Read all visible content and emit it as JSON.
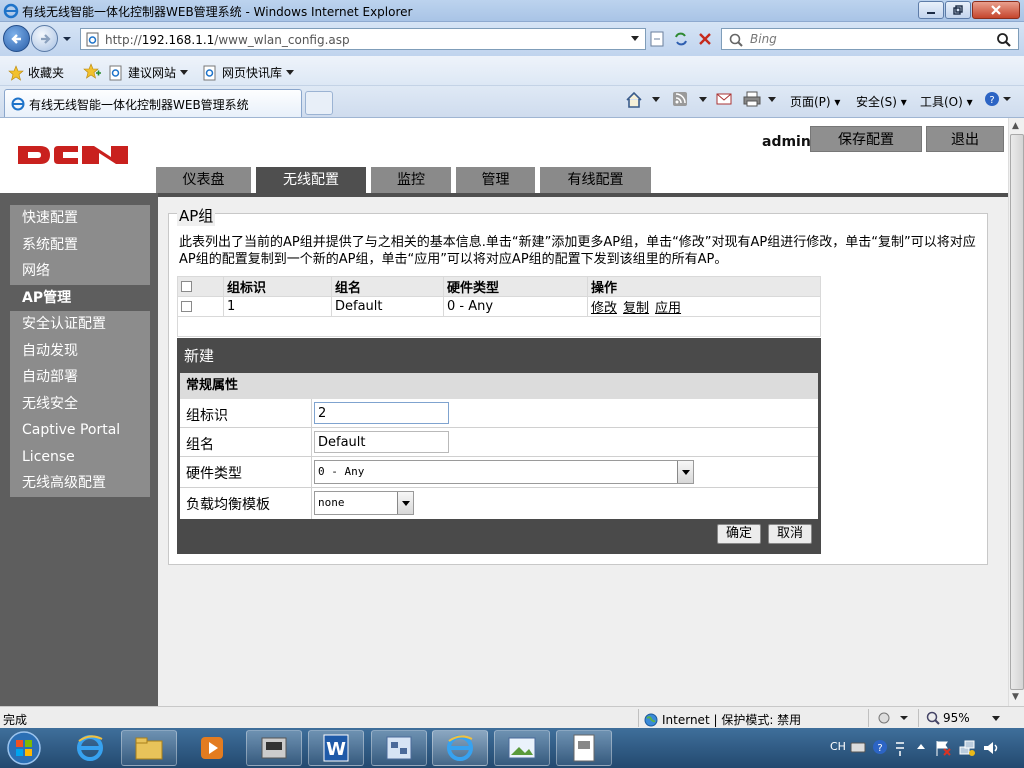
{
  "browser": {
    "window_title": "有线无线智能一体化控制器WEB管理系统 - Windows Internet Explorer",
    "url_prefix": "http://",
    "url_host": "192.168.1.1",
    "url_path": "/www_wlan_config.asp",
    "search_placeholder": "Bing",
    "favorites_label": "收藏夹",
    "suggested_sites": "建议网站",
    "web_slices": "网页快讯库",
    "tab_title": "有线无线智能一体化控制器WEB管理系统",
    "cmd_page": "页面(P)",
    "cmd_safety": "安全(S)",
    "cmd_tools": "工具(O)"
  },
  "header": {
    "logo": "DCN",
    "user": "admin",
    "save_config": "保存配置",
    "logout": "退出"
  },
  "main_tabs": [
    {
      "label": "仪表盘",
      "active": false
    },
    {
      "label": "无线配置",
      "active": true
    },
    {
      "label": "监控",
      "active": false
    },
    {
      "label": "管理",
      "active": false
    },
    {
      "label": "有线配置",
      "active": false
    }
  ],
  "sidebar": {
    "items": [
      {
        "label": "快速配置",
        "active": false
      },
      {
        "label": "系统配置",
        "active": false
      },
      {
        "label": "网络",
        "active": false
      },
      {
        "label": "AP管理",
        "active": true
      },
      {
        "label": "安全认证配置",
        "active": false
      },
      {
        "label": "自动发现",
        "active": false
      },
      {
        "label": "自动部署",
        "active": false
      },
      {
        "label": "无线安全",
        "active": false
      },
      {
        "label": "Captive Portal",
        "active": false
      },
      {
        "label": "License",
        "active": false
      },
      {
        "label": "无线高级配置",
        "active": false
      }
    ]
  },
  "ap_group": {
    "title": "AP组",
    "description": "此表列出了当前的AP组并提供了与之相关的基本信息.单击“新建”添加更多AP组，单击“修改”对现有AP组进行修改，单击“复制”可以将对应AP组的配置复制到一个新的AP组，单击“应用”可以将对应AP组的配置下发到该组里的所有AP。",
    "columns": [
      "组标识",
      "组名",
      "硬件类型",
      "操作"
    ],
    "rows": [
      {
        "id": "1",
        "name": "Default",
        "hardware": "0 - Any",
        "ops": [
          "修改",
          "复制",
          "应用"
        ]
      }
    ]
  },
  "new_form": {
    "title": "新建",
    "section": "常规属性",
    "fields": {
      "group_id": {
        "label": "组标识",
        "value": "2"
      },
      "group_name": {
        "label": "组名",
        "value": "Default"
      },
      "hardware_type": {
        "label": "硬件类型",
        "value": "0 - Any"
      },
      "lb_template": {
        "label": "负载均衡模板",
        "value": "none"
      }
    },
    "confirm": "确定",
    "cancel": "取消"
  },
  "statusbar": {
    "status": "完成",
    "zone": "Internet | 保护模式: 禁用",
    "zoom": "95%"
  },
  "taskbar": {
    "ime": "CH"
  }
}
